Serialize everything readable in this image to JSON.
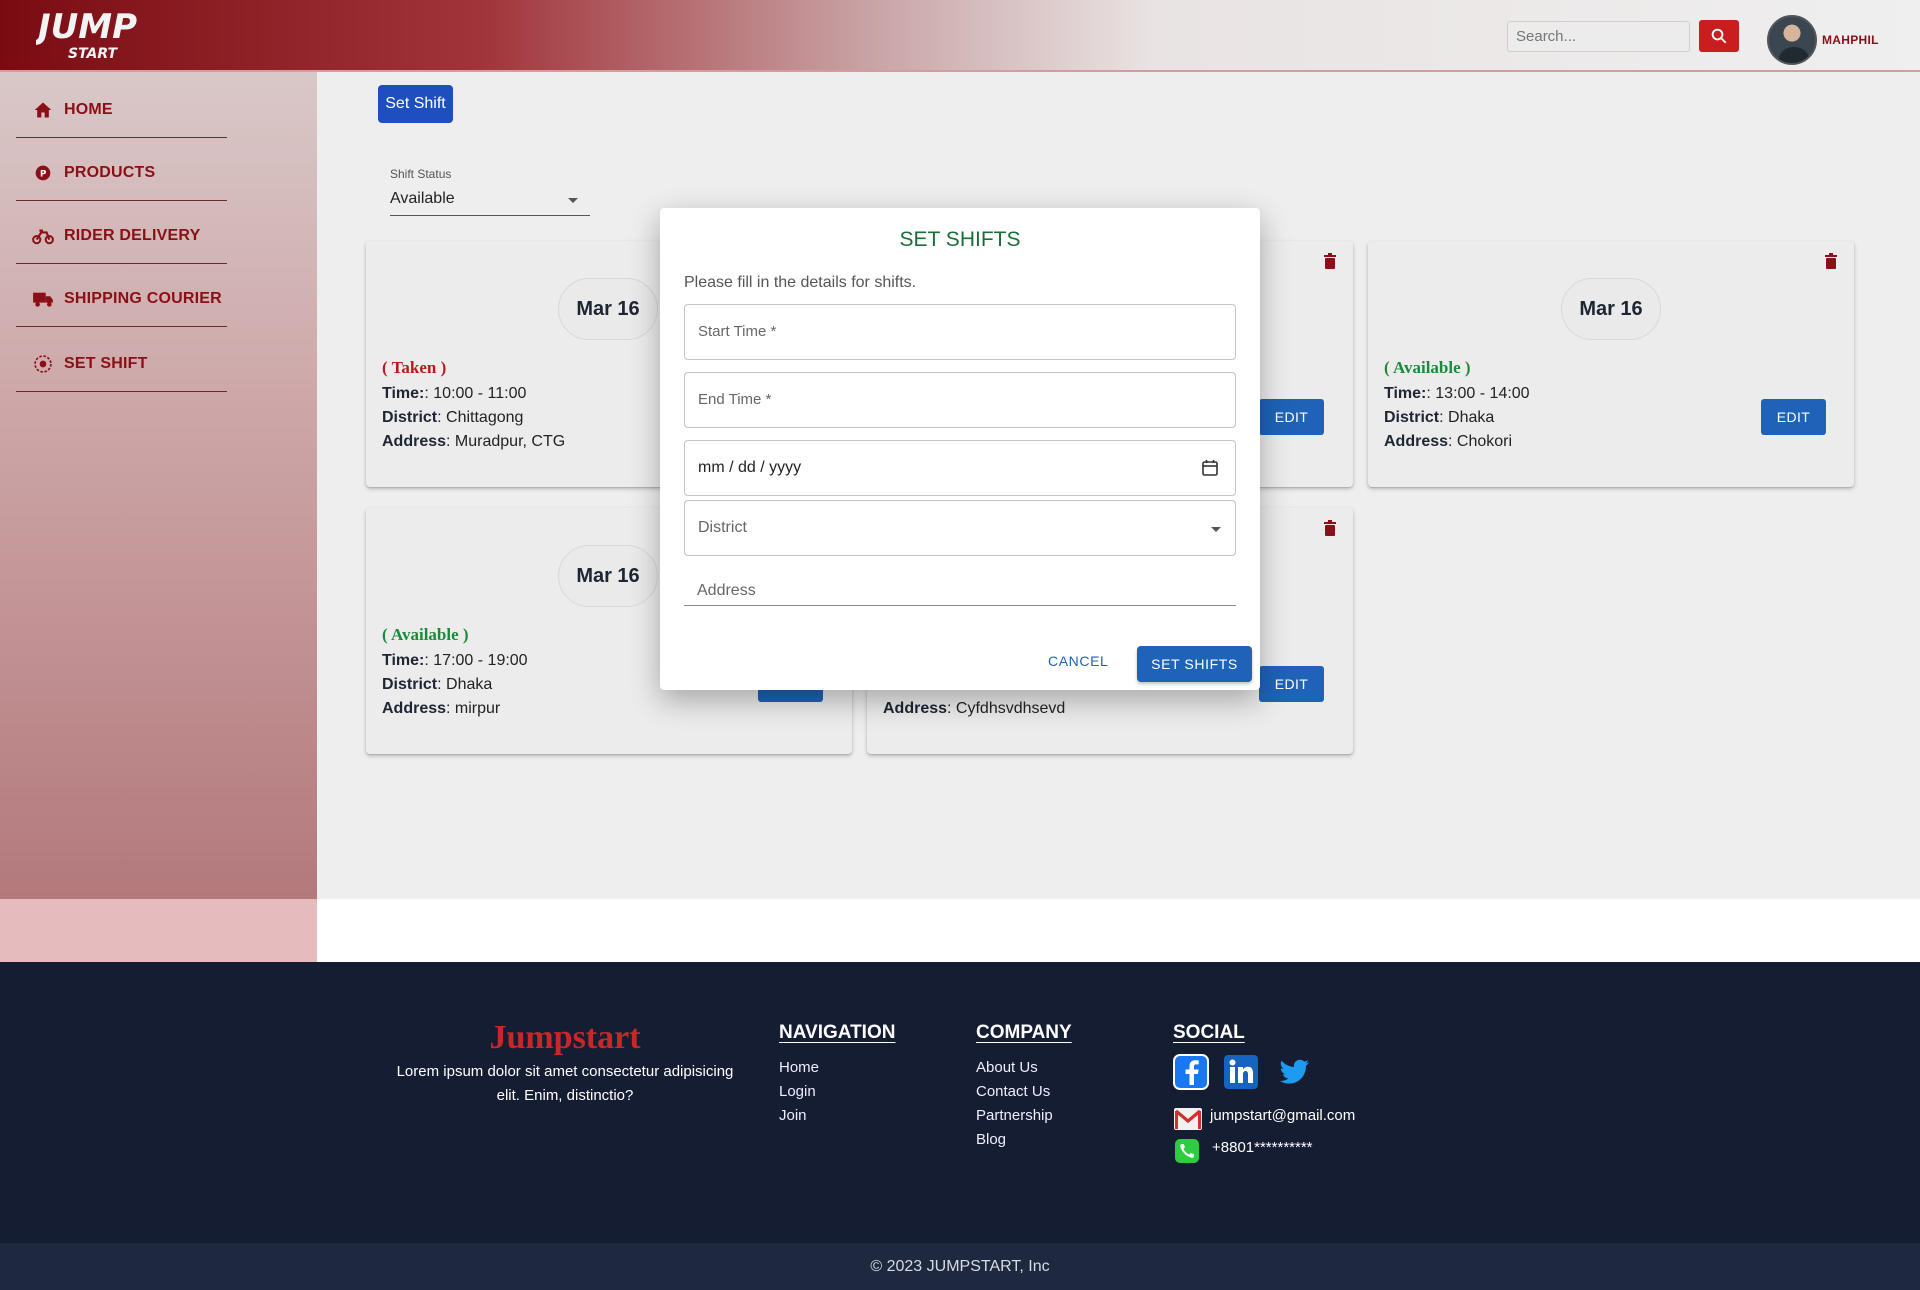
{
  "header": {
    "logo_text": "JUMP START",
    "search_placeholder": "Search...",
    "user_name": "MAHPHIL"
  },
  "sidebar": {
    "items": [
      {
        "label": "HOME",
        "icon": "home-icon"
      },
      {
        "label": "PRODUCTS",
        "icon": "products-icon"
      },
      {
        "label": "RIDER DELIVERY",
        "icon": "motorbike-icon"
      },
      {
        "label": "SHIPPING COURIER",
        "icon": "truck-icon"
      },
      {
        "label": "SET SHIFT",
        "icon": "shift-icon"
      }
    ]
  },
  "main": {
    "set_shift_button": "Set Shift",
    "status_label": "Shift Status",
    "status_value": "Available",
    "cards": [
      {
        "date": "Mar 16",
        "status": "( Taken )",
        "time_label": "Time:",
        "time": ": 10:00 - 11:00",
        "district_label": "District",
        "district": ": Chittagong",
        "address_label": "Address",
        "address": ": Muradpur, CTG"
      },
      {
        "date": "",
        "status": "",
        "time": "",
        "district": "",
        "address": "",
        "edit": "EDIT"
      },
      {
        "date": "Mar 16",
        "status": "( Available )",
        "time_label": "Time:",
        "time": ": 13:00 - 14:00",
        "district_label": "District",
        "district": ": Dhaka",
        "address_label": "Address",
        "address": ": Chokori",
        "edit": "EDIT"
      },
      {
        "date": "Mar 16",
        "status": "( Available )",
        "time_label": "Time:",
        "time": ": 17:00 - 19:00",
        "district_label": "District",
        "district": ": Dhaka",
        "address_label": "Address",
        "address": ": mirpur"
      },
      {
        "date": "",
        "status": "",
        "address_label": "Address",
        "address": ": Cyfdhsvdhsevd",
        "edit": "EDIT"
      }
    ],
    "status_colors": {
      "taken": "#b71c1c",
      "available": "#1b8a3a"
    }
  },
  "dialog": {
    "title": "SET SHIFTS",
    "description": "Please fill in the details for shifts.",
    "start_time_label": "Start Time *",
    "end_time_label": "End Time *",
    "date_placeholder": "mm / dd / yyyy",
    "district_label": "District",
    "address_label": "Address",
    "cancel": "CANCEL",
    "submit": "SET SHIFTS"
  },
  "footer": {
    "brand": "Jumpstart",
    "brand_desc": "Lorem ipsum dolor sit amet consectetur adipisicing elit. Enim, distinctio?",
    "navigation": {
      "title": "NAVIGATION",
      "links": [
        "Home",
        "Login",
        "Join"
      ]
    },
    "company": {
      "title": "COMPANY",
      "links": [
        "About Us",
        "Contact Us",
        "Partnership",
        "Blog"
      ]
    },
    "social": {
      "title": "SOCIAL",
      "icons": [
        "facebook-icon",
        "linkedin-icon",
        "twitter-icon"
      ]
    },
    "email": "jumpstart@gmail.com",
    "phone": "+8801**********",
    "copyright": "© 2023 JUMPSTART, Inc"
  }
}
